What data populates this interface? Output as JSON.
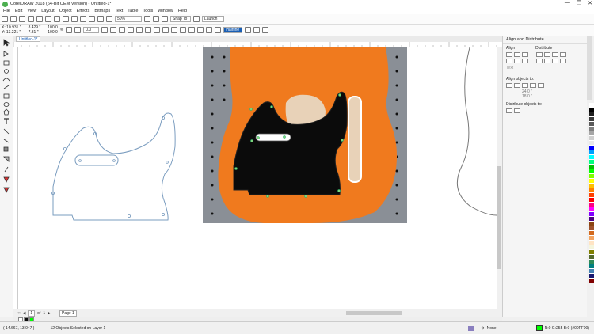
{
  "window": {
    "title": "CorelDRAW 2018 (64-Bit OEM Version) - Untitled-1*",
    "controls": [
      "—",
      "❐",
      "✕"
    ]
  },
  "menu": [
    "File",
    "Edit",
    "View",
    "Layout",
    "Object",
    "Effects",
    "Bitmaps",
    "Text",
    "Table",
    "Tools",
    "Window",
    "Help"
  ],
  "toolbar": {
    "zoom": "50%",
    "snap_to": "Snap To",
    "launch": "Launch"
  },
  "property_bar": {
    "x": "X: 10.931 \"",
    "y": "Y: 13.221 \"",
    "w": "8.429 \"",
    "h": "7.31 \"",
    "scale_w": "100.0",
    "scale_h": "100.0",
    "percent": "%",
    "rotation": "0.0",
    "outline": "Hairline"
  },
  "doc_tab": "Untitled-1*",
  "pagebar": {
    "current": "1",
    "of": "of",
    "total": "1",
    "page_tab": "Page 1"
  },
  "docker": {
    "title": "Align and Distribute",
    "align_label": "Align",
    "distribute_label": "Distribute",
    "text_label": "Text",
    "align_objects_to": "Align objects to:",
    "offset_x": "24.0 \"",
    "offset_y": "18.0 \"",
    "distribute_objects_to": "Distribute objects to:"
  },
  "status": {
    "coords": "( 14.667, 13.047 )",
    "selection": "12 Objects Selected on Layer 1",
    "fill_none": "None",
    "outline_color": "R:0 G:255 B:0 (#00FF00)"
  },
  "colors": {
    "accent": "#1a5fb4",
    "guitar_orange": "#f07a1e",
    "pickguard": "#0b0b0b",
    "outline_blue": "#7a9cbf",
    "node_green": "#7cd37c",
    "status_green": "#00ff00",
    "palette": [
      "#ffffff",
      "#000000",
      "#1e1e1e",
      "#3a3a3a",
      "#5a5a5a",
      "#7f7f7f",
      "#a6a6a6",
      "#cfcfcf",
      "#e9e9e9",
      "#0000ff",
      "#00a0ff",
      "#00ffff",
      "#00ff80",
      "#00c000",
      "#00ff00",
      "#80ff00",
      "#ffff00",
      "#ffc000",
      "#ff8000",
      "#ff4000",
      "#ff0000",
      "#ff0080",
      "#ff00ff",
      "#8000ff",
      "#4b0082",
      "#8b4513",
      "#a0522d",
      "#d2691e",
      "#f4a460",
      "#ffe4c4",
      "#f5f5dc",
      "#808000",
      "#556b2f",
      "#2e8b57",
      "#008080",
      "#4682b4",
      "#191970",
      "#800000"
    ]
  }
}
